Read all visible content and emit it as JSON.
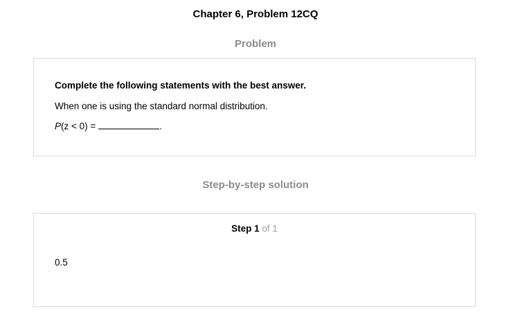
{
  "header": {
    "title": "Chapter 6, Problem 12CQ"
  },
  "problem": {
    "heading": "Problem",
    "instruction": "Complete the following statements with the best answer.",
    "statement": "When one is using the standard normal distribution.",
    "equation_var": "P",
    "equation_rest": "(z < 0) =",
    "equation_end": "."
  },
  "solution": {
    "heading": "Step-by-step solution",
    "step_label": "Step 1",
    "step_total": "of 1",
    "answer": "0.5"
  }
}
